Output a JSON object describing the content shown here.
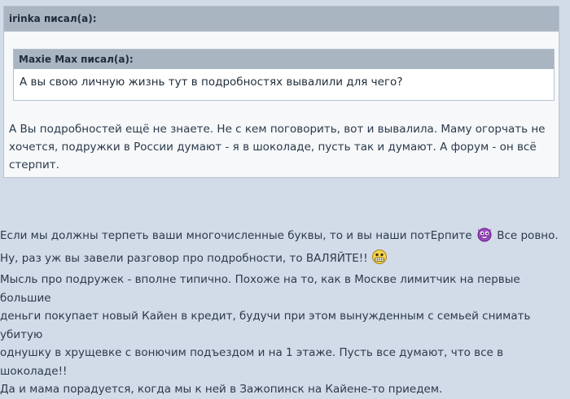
{
  "outer_quote": {
    "author_label": "irinka писал(а):",
    "inner_quote": {
      "author_label": "Maxie Max писал(а):",
      "text": "А вы свою личную жизнь тут в подробностях вывалили для чего?"
    },
    "lines": [
      "А Вы подробностей ещё не знаете. Не с кем поговорить, вот и вывалила. Маму огорчать не",
      "хочется, подружки в России думают - я в шоколаде, пусть так и думают. А форум - он всё",
      "стерпит."
    ]
  },
  "reply": {
    "line1_before": "Если мы должны терпеть ваши многочисленные буквы, то и вы наши потЕрпите",
    "line1_after": "Все ровно.",
    "line2": "Ну, раз уж вы завели разговор про подробности, то ВАЛЯЙТЕ!!",
    "lines_rest": [
      "Мысль про подружек - вполне типично. Похоже на то, как в Москве лимитчик на первые большие",
      "деньги покупает новый Кайен в кредит, будучи при этом вынужденным с семьей снимать убитую",
      "однушку в хрущевке с вонючим подъездом и на 1 этаже. Пусть все думают, что все в шоколаде!!",
      "Да и мама порадуется, когда мы к ней в Зажопинск на Кайене-то приедем."
    ],
    "icons": [
      "devil-grin-smiley-icon",
      "big-grin-smiley-icon"
    ]
  }
}
